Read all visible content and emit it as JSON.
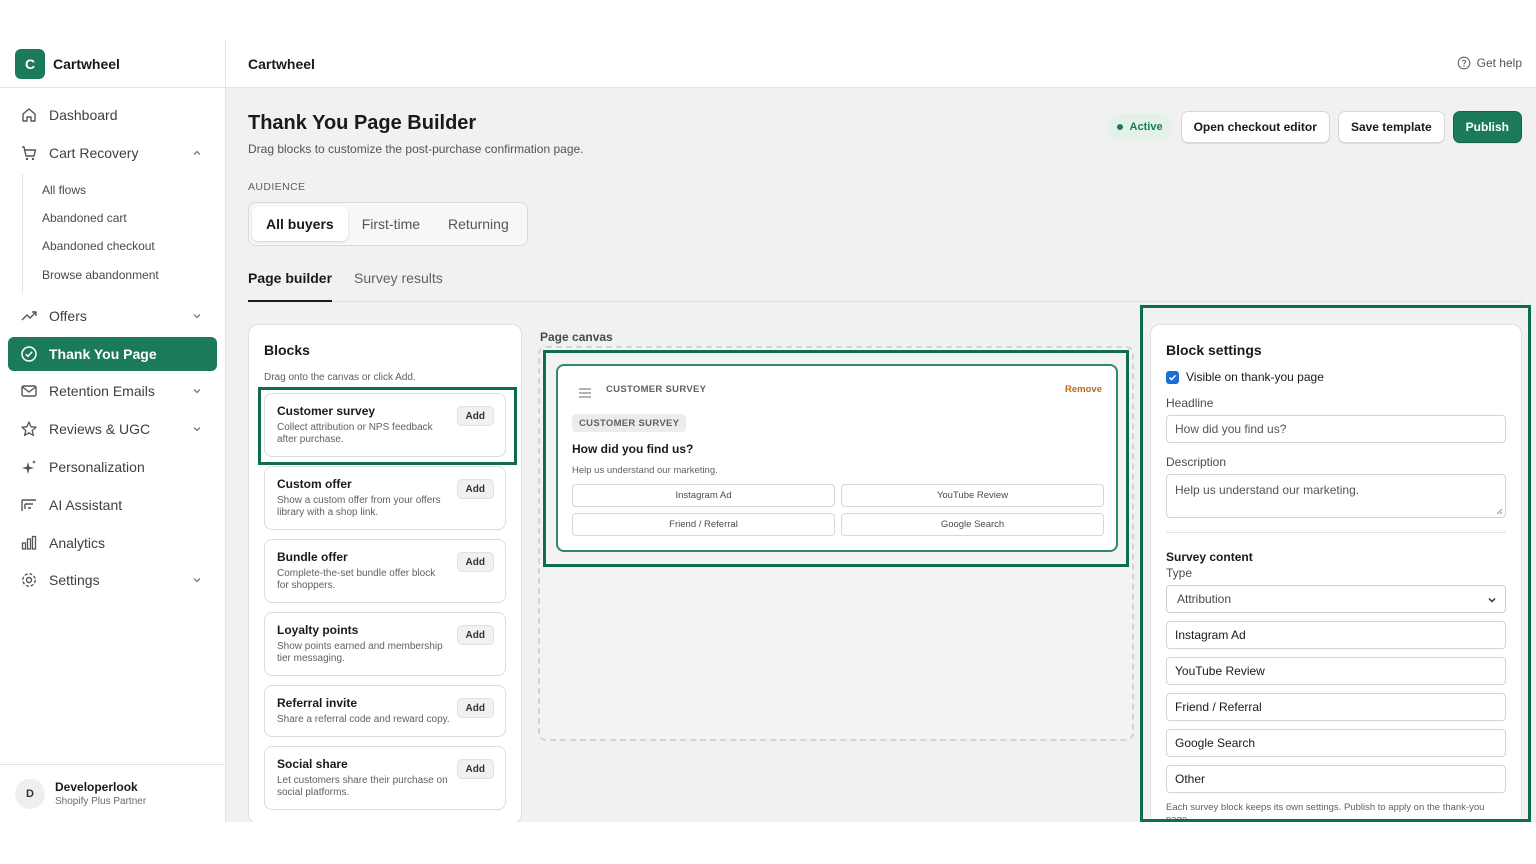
{
  "brand": {
    "logo_letter": "C",
    "name": "Cartwheel"
  },
  "sidebar": {
    "items": [
      {
        "label": "Dashboard"
      },
      {
        "label": "Cart Recovery"
      },
      {
        "label": "Offers"
      },
      {
        "label": "Thank You Page"
      },
      {
        "label": "Retention Emails"
      },
      {
        "label": "Reviews & UGC"
      },
      {
        "label": "Personalization"
      },
      {
        "label": "AI Assistant"
      },
      {
        "label": "Analytics"
      },
      {
        "label": "Settings"
      }
    ],
    "cart_recovery_sub": [
      "All flows",
      "Abandoned cart",
      "Abandoned checkout",
      "Browse abandonment"
    ]
  },
  "user": {
    "initial": "D",
    "name": "Developerlook",
    "role": "Shopify Plus Partner"
  },
  "topbar": {
    "title": "Cartwheel",
    "help": "Get help"
  },
  "page": {
    "title": "Thank You Page Builder",
    "subtitle": "Drag blocks to customize the post-purchase confirmation page.",
    "status": "Active",
    "open_checkout": "Open checkout editor",
    "save_template": "Save template",
    "publish": "Publish"
  },
  "audience": {
    "label": "AUDIENCE",
    "options": [
      "All buyers",
      "First-time",
      "Returning"
    ],
    "selected": "All buyers"
  },
  "tabs": [
    "Page builder",
    "Survey results"
  ],
  "blocks": {
    "title": "Blocks",
    "hint": "Drag onto the canvas or click Add.",
    "add_label": "Add",
    "items": [
      {
        "title": "Customer survey",
        "desc": "Collect attribution or NPS feedback after purchase."
      },
      {
        "title": "Custom offer",
        "desc": "Show a custom offer from your offers library with a shop link."
      },
      {
        "title": "Bundle offer",
        "desc": "Complete-the-set bundle offer block for shoppers."
      },
      {
        "title": "Loyalty points",
        "desc": "Show points earned and membership tier messaging."
      },
      {
        "title": "Referral invite",
        "desc": "Share a referral code and reward copy."
      },
      {
        "title": "Social share",
        "desc": "Let customers share their purchase on social platforms."
      }
    ]
  },
  "canvas": {
    "label": "Page canvas",
    "survey": {
      "header": "CUSTOMER SURVEY",
      "remove": "Remove",
      "tag": "CUSTOMER SURVEY",
      "question": "How did you find us?",
      "description": "Help us understand our marketing.",
      "options": [
        "Instagram Ad",
        "YouTube Review",
        "Friend / Referral",
        "Google Search"
      ]
    }
  },
  "settings": {
    "title": "Block settings",
    "visible_label": "Visible on thank-you page",
    "headline_label": "Headline",
    "headline_value": "How did you find us?",
    "description_label": "Description",
    "description_value": "Help us understand our marketing.",
    "survey_content": "Survey content",
    "type_label": "Type",
    "type_value": "Attribution",
    "options": [
      "Instagram Ad",
      "YouTube Review",
      "Friend / Referral",
      "Google Search",
      "Other"
    ],
    "footer": "Each survey block keeps its own settings. Publish to apply on the thank-you page."
  },
  "colors": {
    "accent": "#1b7a5a",
    "highlight": "#0f6e4a",
    "remove": "#b96a1a"
  }
}
